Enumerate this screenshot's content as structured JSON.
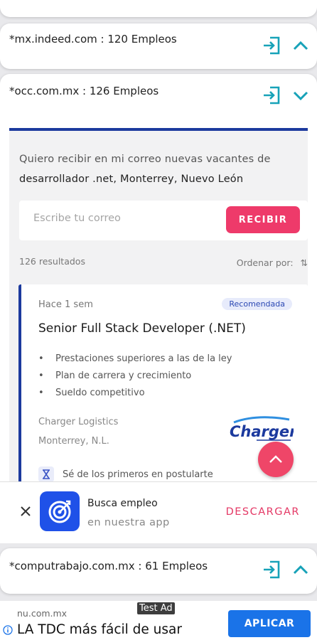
{
  "sources": [
    {
      "label": "*mx.indeed.com : 120 Empleos"
    },
    {
      "label": "*occ.com.mx : 126 Empleos"
    },
    {
      "label": "*computrabajo.com.mx : 61 Empleos"
    }
  ],
  "alert": {
    "intro": "Quiero recibir en mi correo nuevas vacantes de",
    "query": "desarrollador .net, Monterrey, Nuevo León",
    "email_placeholder": "Escribe tu correo",
    "submit_label": "RECIBIR"
  },
  "results": {
    "count_label": "126 resultados",
    "sort_label": "Ordenar por:"
  },
  "job": {
    "posted": "Hace 1 sem",
    "badge": "Recomendada",
    "title": "Senior Full Stack Developer (.NET)",
    "benefits": [
      "Prestaciones superiores a las de la ley",
      "Plan de carrera y crecimiento",
      "Sueldo competitivo"
    ],
    "company": "Charger Logistics",
    "location": "Monterrey, N.L.",
    "logo_text": "Charger",
    "hint": "Sé de los primeros en postularte"
  },
  "promo": {
    "title": "Busca empleo",
    "subtitle": "en nuestra app",
    "download_label": "DESCARGAR"
  },
  "ad": {
    "badge": "Test Ad",
    "domain": "nu.com.mx",
    "headline": "LA TDC más fácil de usar",
    "cta": "APLICAR"
  },
  "colors": {
    "accent_pink": "#ee3a6a",
    "navy": "#1c3a9e",
    "teal_icon": "#17a2b8",
    "ad_blue": "#1a73e8"
  },
  "icons": {
    "open_link": "login-arrow-icon",
    "expand": "chevron-up-icon",
    "collapse": "chevron-down-icon"
  }
}
